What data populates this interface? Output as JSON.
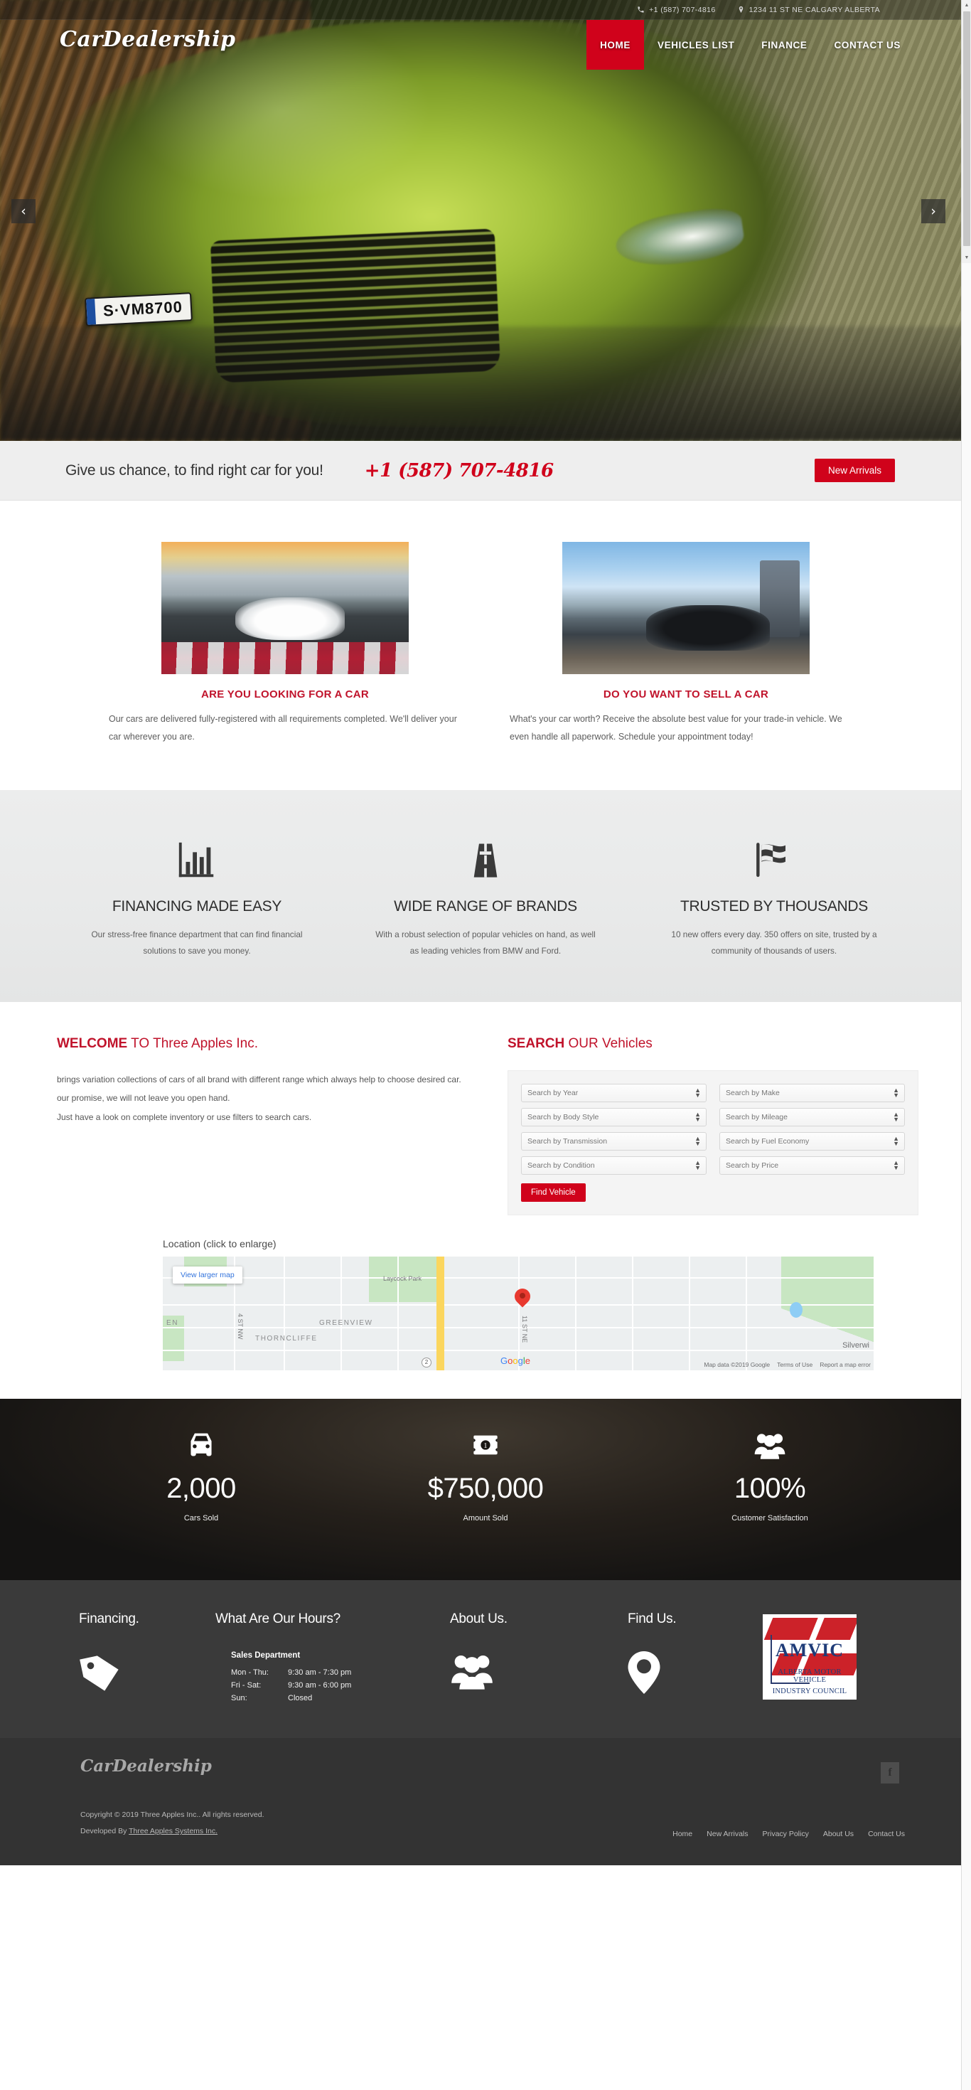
{
  "topbar": {
    "phone": "+1 (587) 707-4816",
    "address": "1234 11 ST NE CALGARY ALBERTA",
    "phone_icon": "phone-icon",
    "location_icon": "map-marker-icon"
  },
  "brand": {
    "name": "CarDealership"
  },
  "nav": {
    "items": [
      {
        "label": "HOME",
        "active": true
      },
      {
        "label": "VEHICLES LIST",
        "active": false
      },
      {
        "label": "FINANCE",
        "active": false
      },
      {
        "label": "CONTACT US",
        "active": false
      }
    ]
  },
  "hero": {
    "prev_label": "‹",
    "next_label": "›",
    "plate_text": "S·VM8700"
  },
  "cta": {
    "text": "Give us chance, to find right car for you!",
    "phone": "+1 (587) 707-4816",
    "button": "New Arrivals"
  },
  "promos": [
    {
      "heading": "ARE YOU LOOKING FOR A CAR",
      "body": "Our cars are delivered fully-registered with all requirements completed. We'll deliver your car wherever you are.",
      "image_name": "white-porsche-911-on-racetrack"
    },
    {
      "heading": "DO YOU WANT TO SELL A CAR",
      "body": "What's your car worth? Receive the absolute best value for your trade-in vehicle. We even handle all paperwork. Schedule your appointment today!",
      "image_name": "black-porsche-cayenne-at-harbour"
    }
  ],
  "features": [
    {
      "icon": "bar-chart-icon",
      "title": "FINANCING MADE EASY",
      "body": "Our stress-free finance department that can find financial solutions to save you money."
    },
    {
      "icon": "road-icon",
      "title": "WIDE RANGE OF BRANDS",
      "body": "With a robust selection of popular vehicles on hand, as well as leading vehicles from BMW and Ford."
    },
    {
      "icon": "checkered-flag-icon",
      "title": "TRUSTED BY THOUSANDS",
      "body": "10 new offers every day. 350 offers on site, trusted by a community of thousands of users."
    }
  ],
  "welcome": {
    "title_bold": "WELCOME",
    "title_rest": " TO Three Apples Inc.",
    "line1": "brings variation collections of cars of all brand with different range which always help to choose desired car. our promise, we will not leave you open hand.",
    "line2": "Just have a look on complete inventory or use filters to search cars."
  },
  "search": {
    "title_bold": "SEARCH",
    "title_rest": " OUR Vehicles",
    "fields": [
      {
        "label": "Search by Year"
      },
      {
        "label": "Search by Make"
      },
      {
        "label": "Search by Body Style"
      },
      {
        "label": "Search by Mileage"
      },
      {
        "label": "Search by Transmission"
      },
      {
        "label": "Search by Fuel Economy"
      },
      {
        "label": "Search by Condition"
      },
      {
        "label": "Search by Price"
      }
    ],
    "button": "Find Vehicle"
  },
  "map": {
    "label": "Location (click to enlarge)",
    "view_larger": "View larger map",
    "labels": {
      "park": "Laycock Park",
      "greenview": "GREENVIEW",
      "thorncliffe": "THORNCLIFFE",
      "street_nw": "4 ST NW",
      "street_ne": "11 ST NE",
      "edge_left": "EN",
      "silverwing": "Silverwi",
      "shield": "2"
    },
    "watermark": {
      "g1": "G",
      "o1": "o",
      "o2": "o",
      "g2": "g",
      "l": "l",
      "e": "e"
    },
    "attribution": [
      "Map data ©2019 Google",
      "Terms of Use",
      "Report a map error"
    ]
  },
  "stats": [
    {
      "icon": "car-icon",
      "value": "2,000",
      "caption": "Cars Sold"
    },
    {
      "icon": "banknote-icon",
      "value": "$750,000",
      "caption": "Amount Sold"
    },
    {
      "icon": "people-group-icon",
      "value": "100%",
      "caption": "Customer Satisfaction"
    }
  ],
  "footer": {
    "financing": {
      "title": "Financing.",
      "icon": "price-tag-icon"
    },
    "hours": {
      "title": "What Are Our Hours?",
      "dept": "Sales Department",
      "rows": [
        {
          "days": "Mon - Thu:",
          "time": "9:30 am - 7:30 pm"
        },
        {
          "days": "Fri - Sat:",
          "time": "9:30 am - 6:00 pm"
        },
        {
          "days": "Sun:",
          "time": "Closed"
        }
      ]
    },
    "about": {
      "title": "About Us.",
      "icon": "people-group-icon"
    },
    "find": {
      "title": "Find Us.",
      "icon": "map-marker-icon"
    },
    "amvic": {
      "acronym": "AMVIC",
      "line1": "ALBERTA MOTOR VEHICLE",
      "line2": "INDUSTRY COUNCIL"
    }
  },
  "bottom": {
    "brand": "CarDealership",
    "social_icon": "facebook-icon",
    "copyright": "Copyright © 2019 Three Apples Inc.. All rights reserved.",
    "developed_prefix": "Developed By ",
    "developed_link": "Three Apples Systems Inc.",
    "links": [
      "Home",
      "New Arrivals",
      "Privacy Policy",
      "About Us",
      "Contact Us"
    ]
  },
  "colors": {
    "accent_red": "#d0021b",
    "heading_red": "#c0132b",
    "footer_dark": "#3a3a3a",
    "footer_bottom": "#333333",
    "features_bg": "#eceded"
  }
}
